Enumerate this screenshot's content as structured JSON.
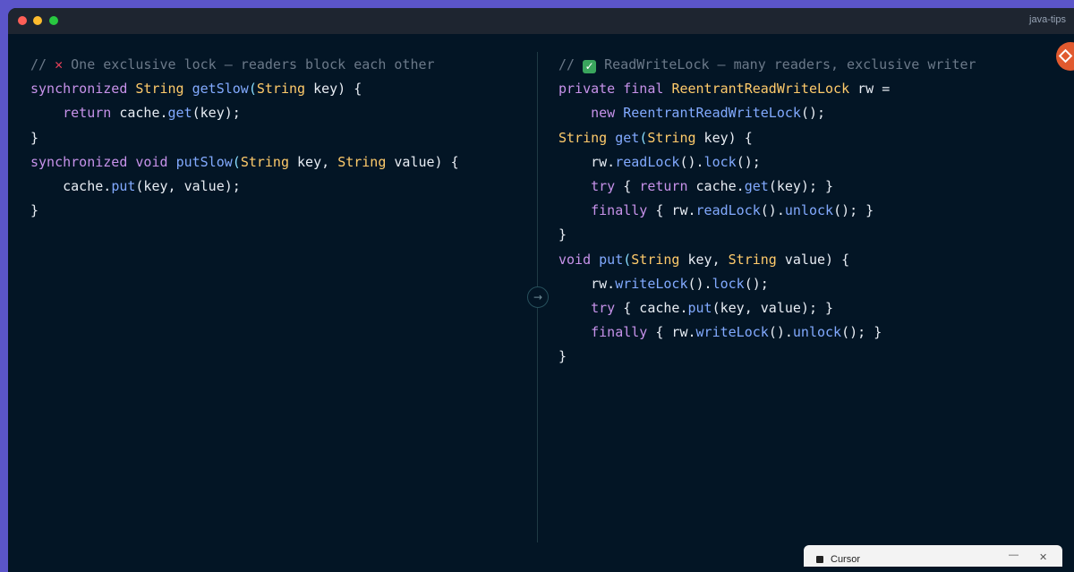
{
  "window": {
    "title": "java-tips"
  },
  "left": {
    "comment_prefix": "// ",
    "comment_icon": "cross-mark-icon",
    "comment_text": " One exclusive lock — readers block each other",
    "l1": {
      "kw": "synchronized",
      "type": "String",
      "fn": "getSlow",
      "p1": "(",
      "ptype": "String",
      "rest": " key) {"
    },
    "l2": {
      "indent": "    ",
      "kw": "return",
      "obj": " cache.",
      "fn": "get",
      "rest": "(key);"
    },
    "l3": "}",
    "l4": {
      "kw": "synchronized",
      "kw2": "void",
      "fn": "putSlow",
      "p1": "(",
      "ptype": "String",
      "mid": " key, ",
      "ptype2": "String",
      "rest": " value) {"
    },
    "l5": {
      "indent": "    ",
      "obj": "cache.",
      "fn": "put",
      "rest": "(key, value);"
    },
    "l6": "}"
  },
  "right": {
    "comment_prefix": "// ",
    "comment_icon": "check-mark-icon",
    "comment_glyph": "✓",
    "comment_text": " ReadWriteLock — many readers, exclusive writer",
    "l1": {
      "kw": "private",
      "kw2": "final",
      "type": "ReentrantReadWriteLock",
      "rest": " rw ="
    },
    "l2": {
      "indent": "    ",
      "kw": "new",
      "fn": "ReentrantReadWriteLock",
      "rest": "();"
    },
    "l3": {
      "type": "String",
      "fn": "get",
      "p1": "(",
      "ptype": "String",
      "rest": " key) {"
    },
    "l4": {
      "indent": "    ",
      "obj": "rw.",
      "fn": "readLock",
      "mid": "().",
      "fn2": "lock",
      "rest": "();"
    },
    "l5": {
      "indent": "    ",
      "kw": "try",
      "a": " { ",
      "kw2": "return",
      "obj": " cache.",
      "fn": "get",
      "rest": "(key); }"
    },
    "l6": {
      "indent": "    ",
      "kw": "finally",
      "a": " { rw.",
      "fn": "readLock",
      "mid": "().",
      "fn2": "unlock",
      "rest": "(); }"
    },
    "l7": "}",
    "l8": {
      "kw": "void",
      "fn": "put",
      "p1": "(",
      "ptype": "String",
      "mid": " key, ",
      "ptype2": "String",
      "rest": " value) {"
    },
    "l9": {
      "indent": "    ",
      "obj": "rw.",
      "fn": "writeLock",
      "mid": "().",
      "fn2": "lock",
      "rest": "();"
    },
    "l10": {
      "indent": "    ",
      "kw": "try",
      "a": " { cache.",
      "fn": "put",
      "rest": "(key, value); }"
    },
    "l11": {
      "indent": "    ",
      "kw": "finally",
      "a": " { rw.",
      "fn": "writeLock",
      "mid": "().",
      "fn2": "unlock",
      "rest": "(); }"
    },
    "l12": "}"
  },
  "divider": {
    "arrow": "→"
  },
  "toast": {
    "title": "Cursor",
    "minimize": "—",
    "close": "✕"
  },
  "colors": {
    "background": "#031525",
    "keyword": "#c792ea",
    "type": "#ffcb6b",
    "function": "#82aaff",
    "comment": "#6b7989",
    "accent": "#5b55c9"
  }
}
